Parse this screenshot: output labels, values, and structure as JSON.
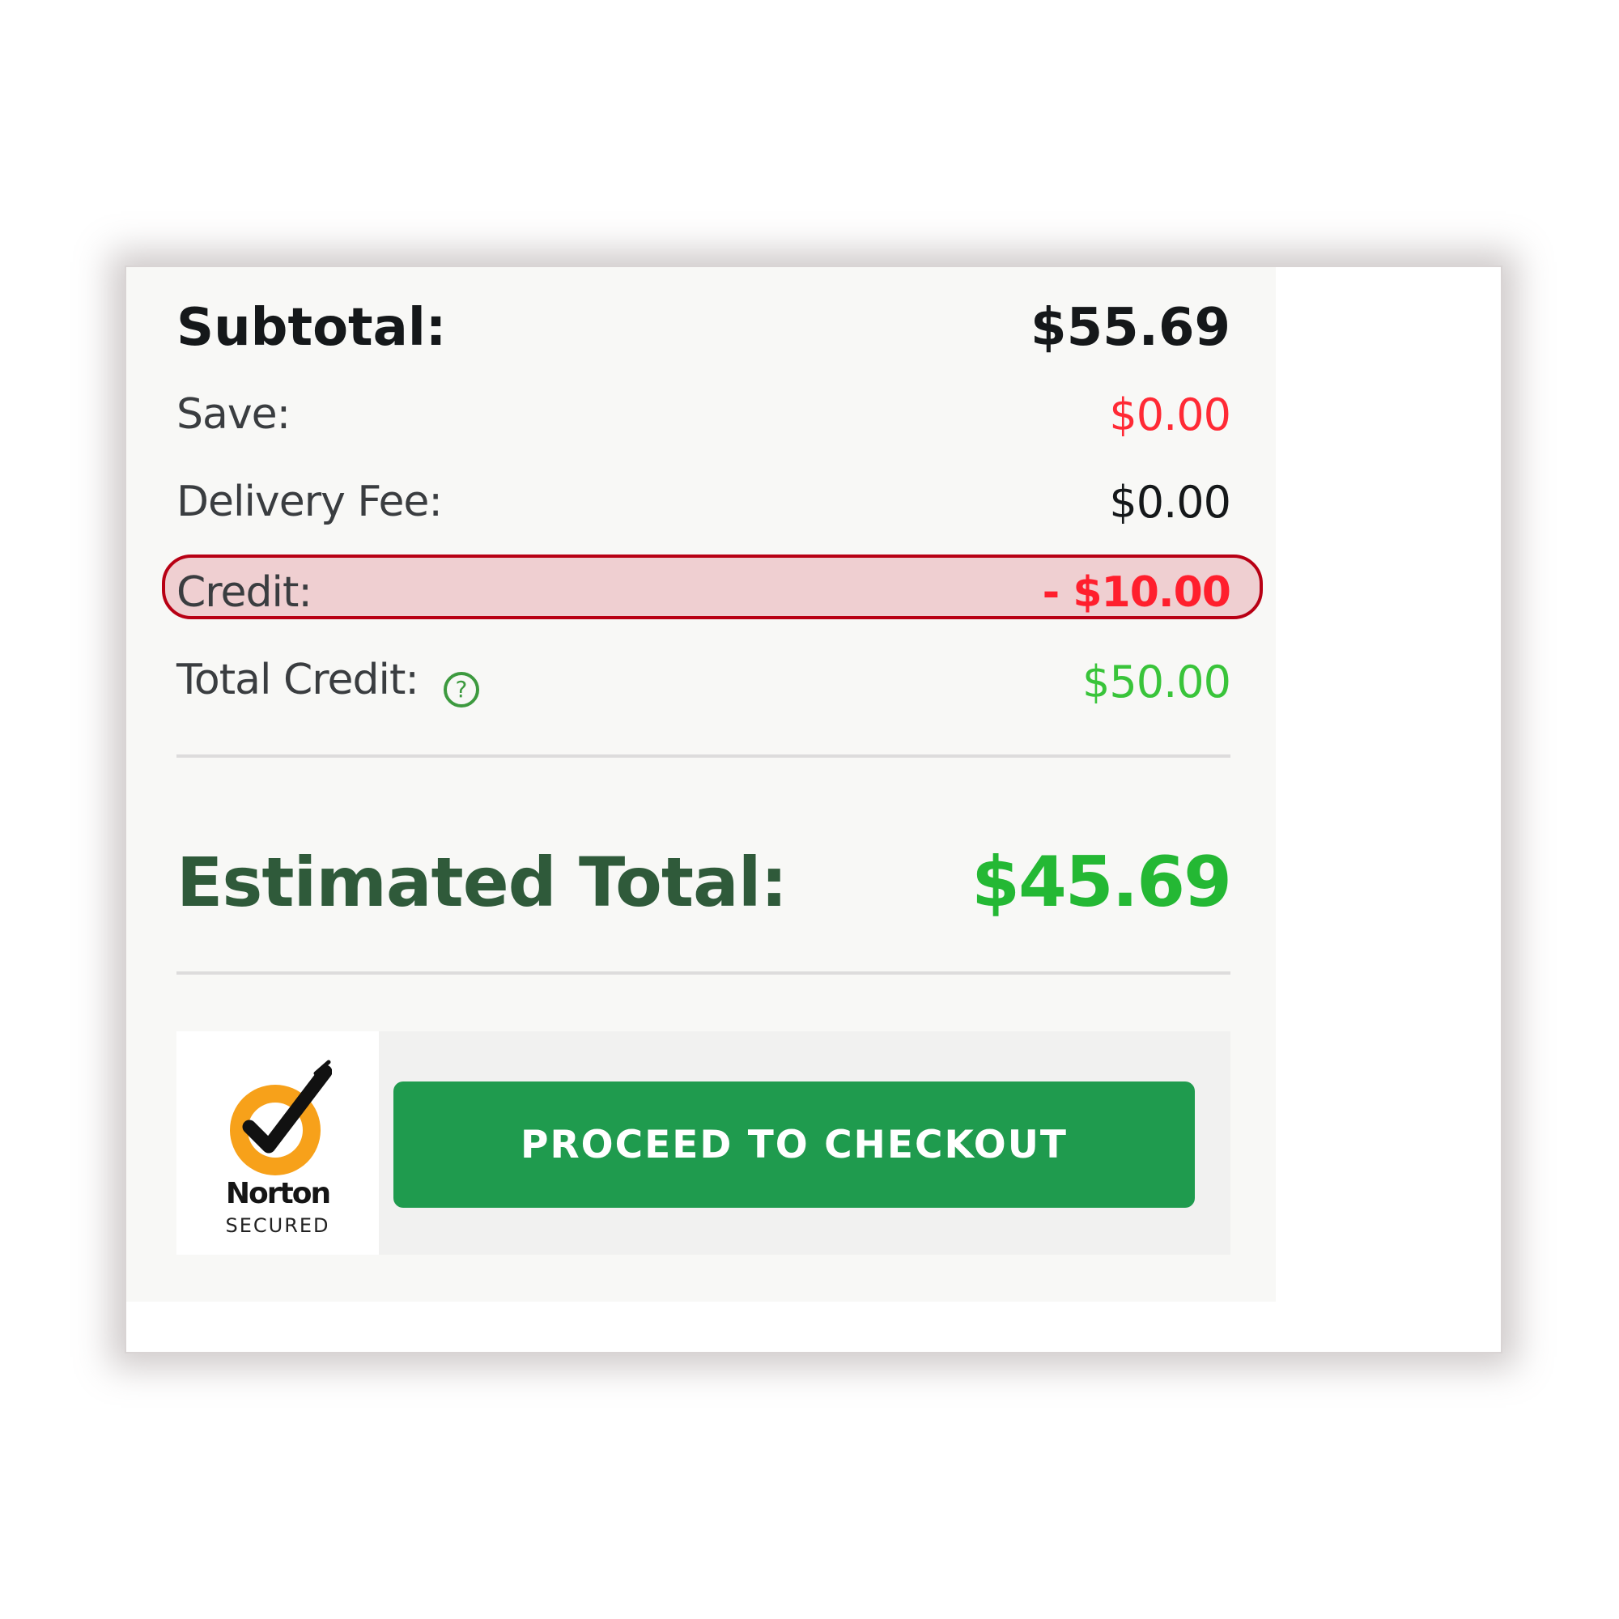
{
  "summary": {
    "subtotal": {
      "label": "Subtotal:",
      "value": "$55.69"
    },
    "save": {
      "label": "Save:",
      "value": "$0.00"
    },
    "delivery_fee": {
      "label": "Delivery Fee:",
      "value": "$0.00"
    },
    "credit": {
      "label": "Credit:",
      "value": "- $10.00"
    },
    "total_credit": {
      "label": "Total Credit:",
      "value": "$50.00",
      "help_icon": "question-circle-icon"
    },
    "estimated_total": {
      "label": "Estimated Total:",
      "value": "$45.69"
    }
  },
  "security_seal": {
    "brand": "Norton",
    "subtitle": "SECURED",
    "icon": "norton-check-icon"
  },
  "checkout": {
    "button_label": "PROCEED TO CHECKOUT"
  },
  "colors": {
    "checkout_green": "#1f9b4e",
    "credit_red": "#ff1f2d",
    "total_green": "#24b834",
    "highlight_border": "#b80014"
  }
}
